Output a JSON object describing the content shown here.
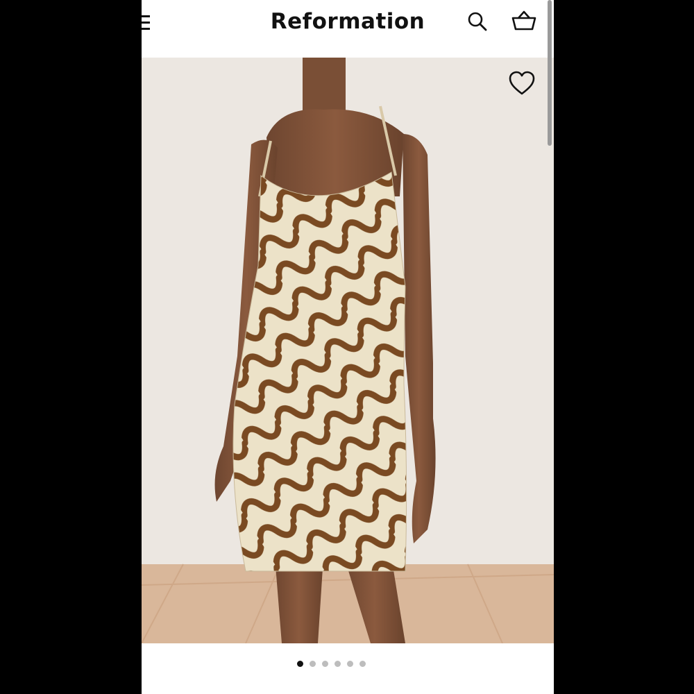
{
  "header": {
    "brand": "Reformation",
    "icons": {
      "menu": "hamburger-menu-icon",
      "search": "search-icon",
      "bag": "shopping-basket-icon"
    }
  },
  "product_image": {
    "wishlist_icon": "heart-icon"
  },
  "carousel": {
    "total_slides": 6,
    "active_index": 0
  },
  "colors": {
    "frame": "#000000",
    "page_bg": "#ffffff",
    "text": "#111111",
    "dot_inactive": "#bdbdbd",
    "dot_active": "#111111",
    "dress_cream": "#ece2c8",
    "dress_brown": "#7a4a22",
    "wall": "#ece7e1",
    "floor": "#d9b79a"
  }
}
